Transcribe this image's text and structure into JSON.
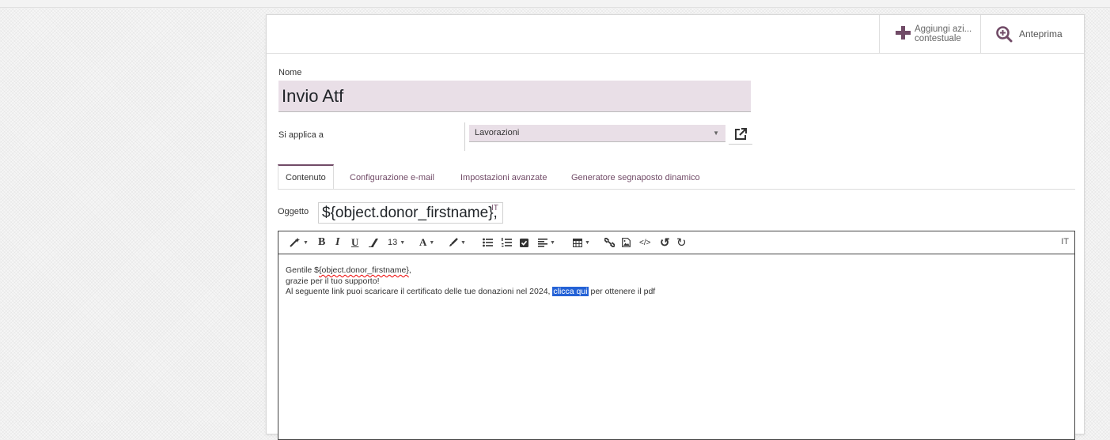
{
  "button_box": {
    "context_action_line1": "Aggiungi azi...",
    "context_action_line2": "contestuale",
    "preview_label": "Anteprima"
  },
  "form": {
    "name_label": "Nome",
    "name_value": "Invio Atf",
    "applies_label": "Si applica a",
    "model_value": "Lavorazioni",
    "subject_label": "Oggetto",
    "subject_value": "${object.donor_firstname},",
    "subject_lang": "IT"
  },
  "tabs": [
    {
      "label": "Contenuto",
      "active": true
    },
    {
      "label": "Configurazione e-mail",
      "active": false
    },
    {
      "label": "Impostazioni avanzate",
      "active": false
    },
    {
      "label": "Generatore segnaposto dinamico",
      "active": false
    }
  ],
  "editor": {
    "font_size": "13",
    "lang": "IT",
    "body": {
      "line1_prefix": "Gentile $",
      "line1_var": "{object.donor_firstname}",
      "line1_suffix": ",",
      "line2": "grazie per il tuo supporto!",
      "line3_prefix": "Al seguente link puoi scaricare il certificato delle tue donazioni nel 2024, ",
      "line3_selected": "clicca qui",
      "line3_suffix": " per ottenere il pdf"
    },
    "toolbar_icons": [
      "magic-wand-icon",
      "bold-icon",
      "italic-icon",
      "underline-icon",
      "eraser-icon",
      "font-size-dropdown",
      "font-color-icon",
      "brush-icon",
      "unordered-list-icon",
      "ordered-list-icon",
      "checklist-icon",
      "align-icon",
      "table-icon",
      "link-icon",
      "image-icon",
      "code-view-icon",
      "undo-icon",
      "redo-icon"
    ]
  },
  "colors": {
    "accent": "#714b67",
    "field_background": "#e9dfe7",
    "selection": "#2462d6"
  }
}
